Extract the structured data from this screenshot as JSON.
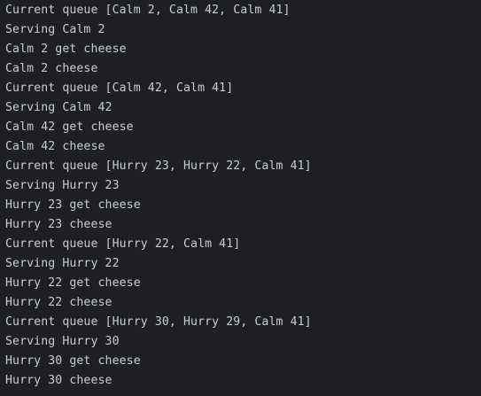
{
  "console": {
    "lines": [
      "Current queue [Calm 2, Calm 42, Calm 41]",
      "Serving Calm 2",
      "Calm 2 get cheese",
      "Calm 2 cheese",
      "Current queue [Calm 42, Calm 41]",
      "Serving Calm 42",
      "Calm 42 get cheese",
      "Calm 42 cheese",
      "Current queue [Hurry 23, Hurry 22, Calm 41]",
      "Serving Hurry 23",
      "Hurry 23 get cheese",
      "Hurry 23 cheese",
      "Current queue [Hurry 22, Calm 41]",
      "Serving Hurry 22",
      "Hurry 22 get cheese",
      "Hurry 22 cheese",
      "Current queue [Hurry 30, Hurry 29, Calm 41]",
      "Serving Hurry 30",
      "Hurry 30 get cheese",
      "Hurry 30 cheese"
    ]
  },
  "colors": {
    "background": "#1e1f22",
    "text": "#c9ccd3"
  }
}
